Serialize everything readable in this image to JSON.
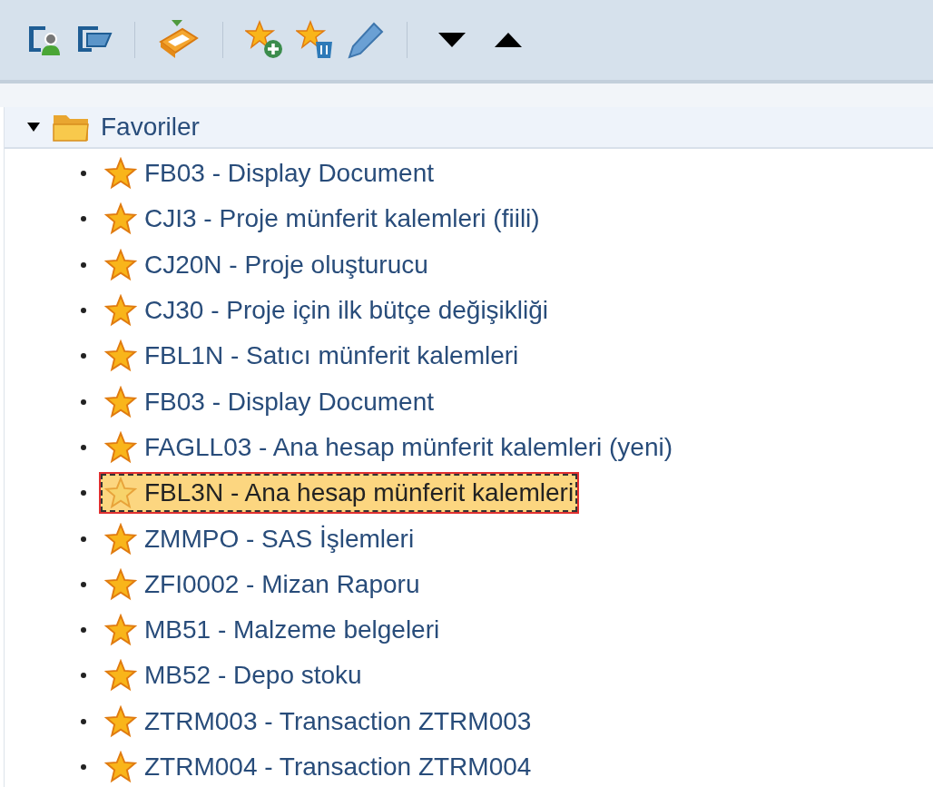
{
  "folder": {
    "label": "Favoriler",
    "expanded": true
  },
  "items": [
    {
      "label": "FB03 - Display Document",
      "selected": false
    },
    {
      "label": "CJI3 - Proje münferit kalemleri (fiili)",
      "selected": false
    },
    {
      "label": "CJ20N - Proje oluşturucu",
      "selected": false
    },
    {
      "label": "CJ30 - Proje için ilk bütçe değişikliği",
      "selected": false
    },
    {
      "label": "FBL1N - Satıcı münferit kalemleri",
      "selected": false
    },
    {
      "label": "FB03 - Display Document",
      "selected": false
    },
    {
      "label": "FAGLL03 - Ana hesap münferit kalemleri (yeni)",
      "selected": false
    },
    {
      "label": "FBL3N - Ana hesap münferit kalemleri",
      "selected": true
    },
    {
      "label": "ZMMPO - SAS İşlemleri",
      "selected": false
    },
    {
      "label": "ZFI0002 - Mizan Raporu",
      "selected": false
    },
    {
      "label": "MB51 - Malzeme belgeleri",
      "selected": false
    },
    {
      "label": "MB52 - Depo stoku",
      "selected": false
    },
    {
      "label": "ZTRM003 - Transaction ZTRM003",
      "selected": false
    },
    {
      "label": "ZTRM004 - Transaction ZTRM004",
      "selected": false
    }
  ]
}
